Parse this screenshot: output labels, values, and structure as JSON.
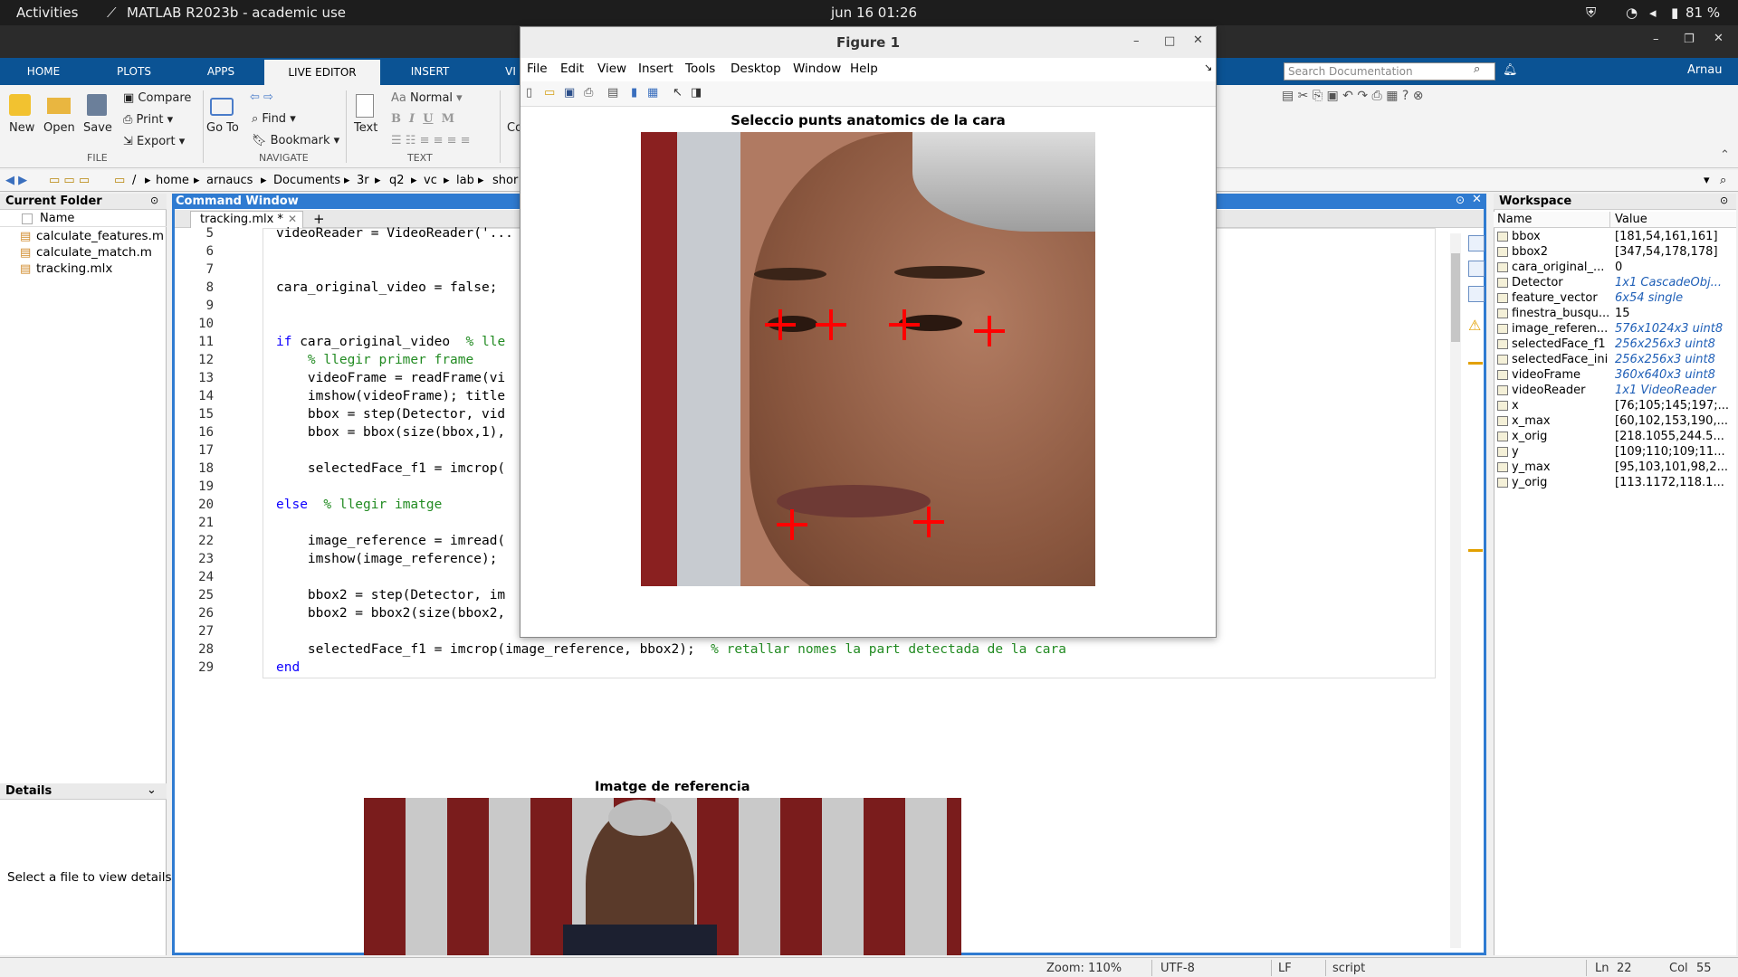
{
  "topbar": {
    "activities": "Activities",
    "app": "MATLAB R2023b - academic use",
    "clock": "jun 16  01:26",
    "battery": "81 %"
  },
  "tabs": [
    "HOME",
    "PLOTS",
    "APPS",
    "LIVE EDITOR",
    "INSERT",
    "VIEW"
  ],
  "ribbon": {
    "new": "New",
    "open": "Open",
    "save": "Save",
    "compare": "Compare",
    "print": "Print",
    "export": "Export",
    "goto": "Go To",
    "find": "Find",
    "bookmark": "Bookmark",
    "text": "Text",
    "normal": "Normal",
    "code": "Co",
    "file_sec": "FILE",
    "nav_sec": "NAVIGATE",
    "text_sec": "TEXT",
    "search_placeholder": "Search Documentation",
    "user": "Arnau"
  },
  "path": [
    "/",
    "home",
    "arnaucs",
    "Documents",
    "3r",
    "q2",
    "vc",
    "lab",
    "shor"
  ],
  "current_folder": {
    "title": "Current Folder",
    "col": "Name",
    "files": [
      "calculate_features.m",
      "calculate_match.m",
      "tracking.mlx"
    ]
  },
  "details": {
    "title": "Details",
    "msg": "Select a file to view details"
  },
  "command_window": "Command Window",
  "editor_tab": "tracking.mlx *",
  "code": [
    {
      "n": "5",
      "t": "videoReader = VideoReader('..."
    },
    {
      "n": "6",
      "t": ""
    },
    {
      "n": "7",
      "t": ""
    },
    {
      "n": "8",
      "t": "cara_original_video = false;"
    },
    {
      "n": "9",
      "t": ""
    },
    {
      "n": "10",
      "t": ""
    },
    {
      "n": "11",
      "k": "if",
      "t": " cara_original_video  ",
      "c": "% lle"
    },
    {
      "n": "12",
      "t": "    ",
      "c": "% llegir primer frame"
    },
    {
      "n": "13",
      "t": "    videoFrame = readFrame(vi"
    },
    {
      "n": "14",
      "t": "    imshow(videoFrame); title"
    },
    {
      "n": "15",
      "t": "    bbox = step(Detector, vid"
    },
    {
      "n": "16",
      "t": "    bbox = bbox(size(bbox,1),"
    },
    {
      "n": "17",
      "t": ""
    },
    {
      "n": "18",
      "t": "    selectedFace_f1 = imcrop("
    },
    {
      "n": "19",
      "t": ""
    },
    {
      "n": "20",
      "k": "else",
      "t": "  ",
      "c": "% llegir imatge"
    },
    {
      "n": "21",
      "t": ""
    },
    {
      "n": "22",
      "t": "    image_reference = imread("
    },
    {
      "n": "23",
      "t": "    imshow(image_reference);"
    },
    {
      "n": "24",
      "t": ""
    },
    {
      "n": "25",
      "t": "    bbox2 = step(Detector, im"
    },
    {
      "n": "26",
      "t": "    bbox2 = bbox2(size(bbox2,"
    },
    {
      "n": "27",
      "t": ""
    },
    {
      "n": "28",
      "t": "    selectedFace_f1 = imcrop(image_reference, bbox2);  ",
      "c": "% retallar nomes la part detectada de la cara"
    },
    {
      "n": "29",
      "k": "end",
      "t": ""
    }
  ],
  "ref_title": "Imatge de referencia",
  "workspace": {
    "title": "Workspace",
    "col_name": "Name",
    "col_value": "Value",
    "vars": [
      {
        "n": "bbox",
        "v": "[181,54,161,161]",
        "i": false
      },
      {
        "n": "bbox2",
        "v": "[347,54,178,178]",
        "i": false
      },
      {
        "n": "cara_original_...",
        "v": "0",
        "i": false
      },
      {
        "n": "Detector",
        "v": "1x1 CascadeObj...",
        "i": true
      },
      {
        "n": "feature_vector",
        "v": "6x54 single",
        "i": true
      },
      {
        "n": "finestra_busqu...",
        "v": "15",
        "i": false
      },
      {
        "n": "image_referen...",
        "v": "576x1024x3 uint8",
        "i": true
      },
      {
        "n": "selectedFace_f1",
        "v": "256x256x3 uint8",
        "i": true
      },
      {
        "n": "selectedFace_ini",
        "v": "256x256x3 uint8",
        "i": true
      },
      {
        "n": "videoFrame",
        "v": "360x640x3 uint8",
        "i": true
      },
      {
        "n": "videoReader",
        "v": "1x1 VideoReader",
        "i": true
      },
      {
        "n": "x",
        "v": "[76;105;145;197;...",
        "i": false
      },
      {
        "n": "x_max",
        "v": "[60,102,153,190,...",
        "i": false
      },
      {
        "n": "x_orig",
        "v": "[218.1055,244.5...",
        "i": false
      },
      {
        "n": "y",
        "v": "[109;110;109;11...",
        "i": false
      },
      {
        "n": "y_max",
        "v": "[95,103,101,98,2...",
        "i": false
      },
      {
        "n": "y_orig",
        "v": "[113.1172,118.1...",
        "i": false
      }
    ]
  },
  "figure": {
    "title": "Figure 1",
    "menus": [
      "File",
      "Edit",
      "View",
      "Insert",
      "Tools",
      "Desktop",
      "Window",
      "Help"
    ],
    "plot_title": "Seleccio punts anatomics de la cara"
  },
  "status": {
    "zoom": "Zoom: 110%",
    "enc": "UTF-8",
    "eol": "LF",
    "type": "script",
    "ln_label": "Ln",
    "ln": "22",
    "col_label": "Col",
    "col": "55"
  }
}
